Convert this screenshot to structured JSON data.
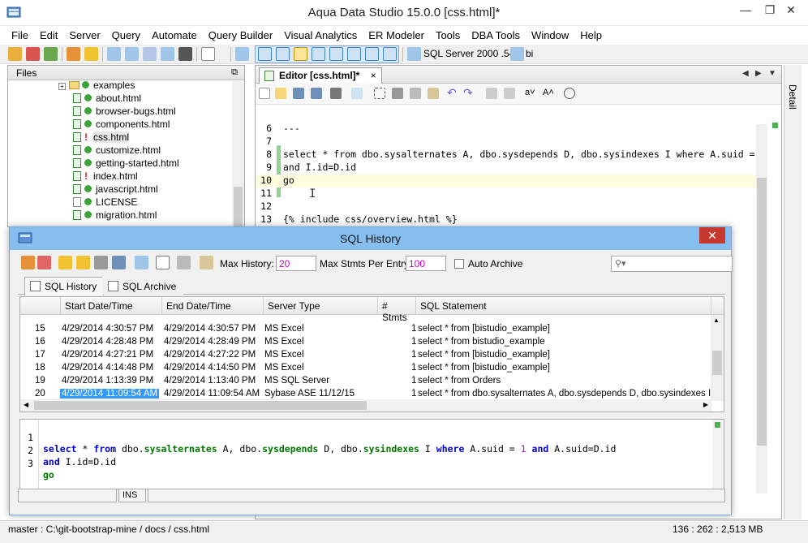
{
  "window": {
    "title": "Aqua Data Studio 15.0.0 [css.html]*"
  },
  "menu": [
    "File",
    "Edit",
    "Server",
    "Query",
    "Automate",
    "Query Builder",
    "Visual Analytics",
    "ER Modeler",
    "Tools",
    "DBA Tools",
    "Window",
    "Help"
  ],
  "toolbar": {
    "server_label": "SQL Server 2000 .54",
    "db_label": "bi"
  },
  "files": {
    "header": "Files",
    "items": [
      {
        "label": "examples",
        "type": "folder"
      },
      {
        "label": "about.html",
        "status": "ok"
      },
      {
        "label": "browser-bugs.html",
        "status": "ok"
      },
      {
        "label": "components.html",
        "status": "ok"
      },
      {
        "label": "css.html",
        "status": "modified"
      },
      {
        "label": "customize.html",
        "status": "ok"
      },
      {
        "label": "getting-started.html",
        "status": "ok"
      },
      {
        "label": "index.html",
        "status": "modified"
      },
      {
        "label": "javascript.html",
        "status": "ok"
      },
      {
        "label": "LICENSE",
        "status": "ok"
      },
      {
        "label": "migration.html",
        "status": "ok"
      }
    ]
  },
  "editor": {
    "tab_label": "Editor [css.html]*",
    "close_glyph": "×",
    "lines": [
      {
        "n": "6",
        "text": "---"
      },
      {
        "n": "7",
        "text": ""
      },
      {
        "n": "8",
        "text": "select * from dbo.sysalternates A, dbo.sysdepends D, dbo.sysindexes I where A.suid ="
      },
      {
        "n": "9",
        "text": "and I.id=D.id"
      },
      {
        "n": "10",
        "text": "go"
      },
      {
        "n": "11",
        "text": ""
      },
      {
        "n": "12",
        "text": ""
      },
      {
        "n": "13",
        "text": "{% include css/overview.html %}"
      }
    ]
  },
  "detail_label": "Detail",
  "status": {
    "path": "master : C:\\git-bootstrap-mine / docs / css.html",
    "position": "136 : 262 : 2,513 MB"
  },
  "sql_history": {
    "title": "SQL History",
    "close_glyph": "✕",
    "max_history_label": "Max History:",
    "max_history_value": "20",
    "max_stmts_label": "Max Stmts Per Entry:",
    "max_stmts_value": "100",
    "auto_archive_label": "Auto Archive",
    "tabs": [
      "SQL History",
      "SQL Archive"
    ],
    "columns": [
      "",
      "Start Date/Time",
      "End Date/Time",
      "Server Type",
      "# Stmts",
      "SQL Statement"
    ],
    "rows": [
      {
        "n": "15",
        "start": "4/29/2014 4:30:57 PM",
        "end": "4/29/2014 4:30:57 PM",
        "server": "MS Excel",
        "stmts": "1",
        "sql": "select * from [bistudio_example]"
      },
      {
        "n": "16",
        "start": "4/29/2014 4:28:48 PM",
        "end": "4/29/2014 4:28:49 PM",
        "server": "MS Excel",
        "stmts": "1",
        "sql": "select * from bistudio_example"
      },
      {
        "n": "17",
        "start": "4/29/2014 4:27:21 PM",
        "end": "4/29/2014 4:27:22 PM",
        "server": "MS Excel",
        "stmts": "1",
        "sql": "select * from [bistudio_example]"
      },
      {
        "n": "18",
        "start": "4/29/2014 4:14:48 PM",
        "end": "4/29/2014 4:14:50 PM",
        "server": "MS Excel",
        "stmts": "1",
        "sql": "select * from [bistudio_example]"
      },
      {
        "n": "19",
        "start": "4/29/2014 1:13:39 PM",
        "end": "4/29/2014 1:13:40 PM",
        "server": "MS SQL Server",
        "stmts": "1",
        "sql": "select * from Orders"
      },
      {
        "n": "20",
        "start": "4/29/2014 11:09:54 AM",
        "end": "4/29/2014 11:09:54 AM",
        "server": "Sybase ASE 11/12/15",
        "stmts": "1",
        "sql": "select * from dbo.sysalternates A, dbo.sysdepends D, dbo.sysindexes I wh"
      }
    ],
    "preview": {
      "l1_n": "1",
      "l2_n": "2",
      "l3_n": "3",
      "kw_select": "select",
      "star": " * ",
      "kw_from": "from",
      "sp": " ",
      "o1": "dbo.",
      "o1b": "sysalternates",
      "a1": " A, ",
      "o2": "dbo.",
      "o2b": "sysdepends",
      "a2": " D, ",
      "o3": "dbo.",
      "o3b": "sysindexes",
      "a3": " I ",
      "kw_where": "where",
      "cond1": " A.suid = ",
      "one": "1",
      "sp2": " ",
      "kw_and": "and",
      "cond2": " A.suid=D.id",
      "kw_and2": "and",
      "cond3": " I.id=D.id",
      "kw_go": "go"
    },
    "ins_label": "INS"
  }
}
